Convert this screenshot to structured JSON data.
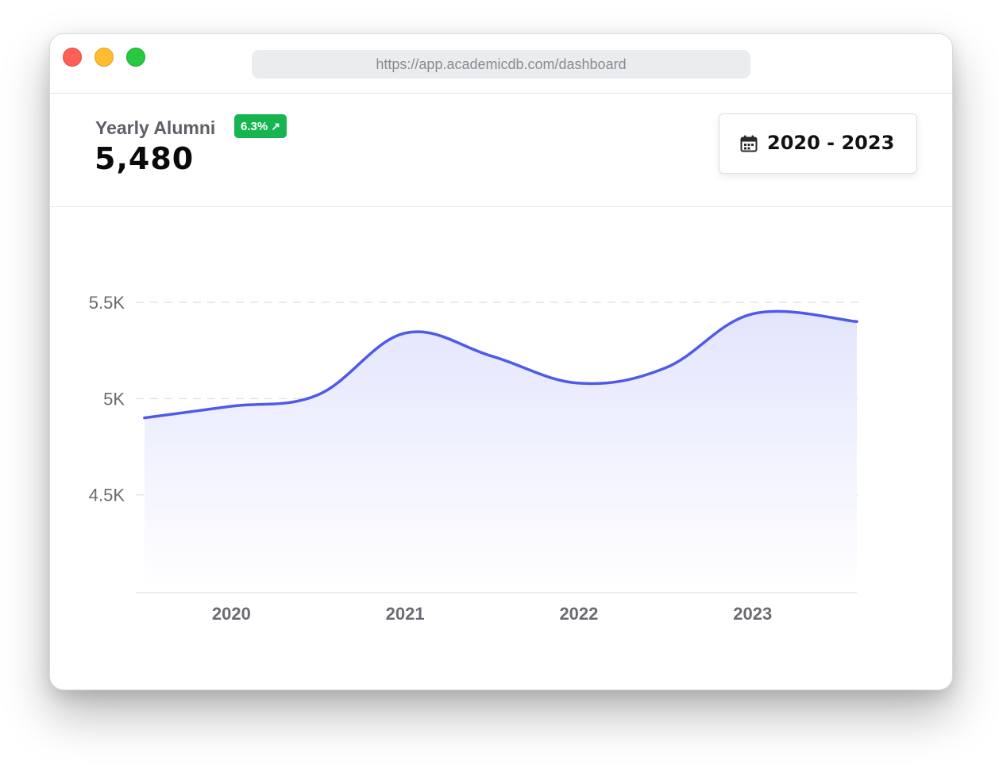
{
  "window": {
    "url": "https://app.academicdb.com/dashboard"
  },
  "header": {
    "title": "Yearly Alumni",
    "badge": "6.3%",
    "badge_icon": "arrow-up-right-icon",
    "value": "5,480",
    "date_range": "2020 - 2023",
    "date_icon": "calendar-icon"
  },
  "colors": {
    "line": "#4f5ae8",
    "badge": "#16b550",
    "fill_top": "#e3e5fd",
    "grid": "#e3e3e8"
  },
  "chart_data": {
    "type": "area",
    "x": [
      2019.5,
      2020,
      2020.5,
      2021,
      2021.5,
      2022,
      2022.5,
      2023,
      2023.6
    ],
    "values": [
      4900,
      4960,
      5020,
      5340,
      5220,
      5080,
      5160,
      5440,
      5400
    ],
    "x_ticks": [
      "2020",
      "2021",
      "2022",
      "2023"
    ],
    "x_tick_values": [
      2020,
      2021,
      2022,
      2023
    ],
    "y_ticks": [
      "5.5K",
      "5K",
      "4.5K"
    ],
    "y_tick_values": [
      5500,
      5000,
      4500
    ],
    "xlim": [
      2019.45,
      2023.6
    ],
    "ylim": [
      4000,
      5500
    ],
    "grid": true,
    "legend": "none"
  }
}
